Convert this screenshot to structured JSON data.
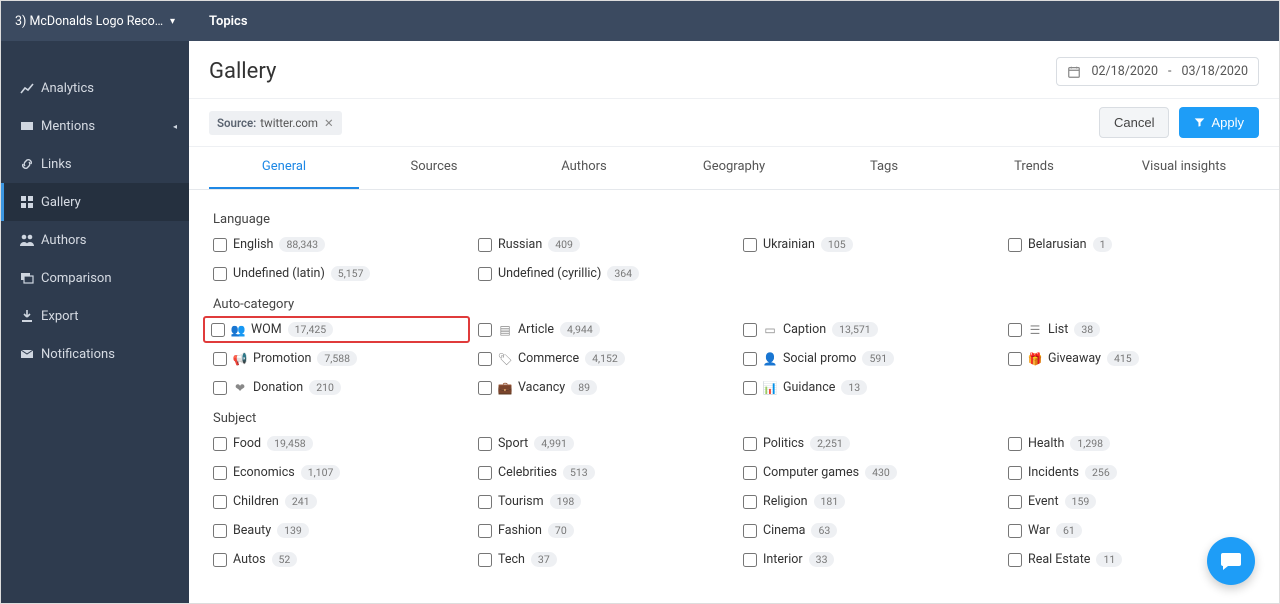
{
  "project": {
    "label": "3) McDonalds Logo Reco…"
  },
  "topbar": {
    "title": "Topics"
  },
  "nav": {
    "items": [
      {
        "label": "Analytics"
      },
      {
        "label": "Mentions"
      },
      {
        "label": "Links"
      },
      {
        "label": "Gallery"
      },
      {
        "label": "Authors"
      },
      {
        "label": "Comparison"
      },
      {
        "label": "Export"
      },
      {
        "label": "Notifications"
      }
    ]
  },
  "page": {
    "title": "Gallery"
  },
  "date_range": {
    "from": "02/18/2020",
    "sep": "-",
    "to": "03/18/2020"
  },
  "filter_chip": {
    "key": "Source:",
    "value": "twitter.com"
  },
  "buttons": {
    "cancel": "Cancel",
    "apply": "Apply"
  },
  "tabs": {
    "items": [
      {
        "label": "General"
      },
      {
        "label": "Sources"
      },
      {
        "label": "Authors"
      },
      {
        "label": "Geography"
      },
      {
        "label": "Tags"
      },
      {
        "label": "Trends"
      },
      {
        "label": "Visual insights"
      }
    ]
  },
  "sections": {
    "language": {
      "title": "Language",
      "opts": [
        {
          "label": "English",
          "count": "88,343"
        },
        {
          "label": "Russian",
          "count": "409"
        },
        {
          "label": "Ukrainian",
          "count": "105"
        },
        {
          "label": "Belarusian",
          "count": "1"
        },
        {
          "label": "Undefined (latin)",
          "count": "5,157"
        },
        {
          "label": "Undefined (cyrillic)",
          "count": "364"
        }
      ]
    },
    "auto_category": {
      "title": "Auto-category",
      "opts": [
        {
          "label": "WOM",
          "count": "17,425",
          "highlight": true
        },
        {
          "label": "Article",
          "count": "4,944"
        },
        {
          "label": "Caption",
          "count": "13,571"
        },
        {
          "label": "List",
          "count": "38"
        },
        {
          "label": "Promotion",
          "count": "7,588"
        },
        {
          "label": "Commerce",
          "count": "4,152"
        },
        {
          "label": "Social promo",
          "count": "591"
        },
        {
          "label": "Giveaway",
          "count": "415"
        },
        {
          "label": "Donation",
          "count": "210"
        },
        {
          "label": "Vacancy",
          "count": "89"
        },
        {
          "label": "Guidance",
          "count": "13"
        }
      ]
    },
    "subject": {
      "title": "Subject",
      "opts": [
        {
          "label": "Food",
          "count": "19,458"
        },
        {
          "label": "Sport",
          "count": "4,991"
        },
        {
          "label": "Politics",
          "count": "2,251"
        },
        {
          "label": "Health",
          "count": "1,298"
        },
        {
          "label": "Economics",
          "count": "1,107"
        },
        {
          "label": "Celebrities",
          "count": "513"
        },
        {
          "label": "Computer games",
          "count": "430"
        },
        {
          "label": "Incidents",
          "count": "256"
        },
        {
          "label": "Children",
          "count": "241"
        },
        {
          "label": "Tourism",
          "count": "198"
        },
        {
          "label": "Religion",
          "count": "181"
        },
        {
          "label": "Event",
          "count": "159"
        },
        {
          "label": "Beauty",
          "count": "139"
        },
        {
          "label": "Fashion",
          "count": "70"
        },
        {
          "label": "Cinema",
          "count": "63"
        },
        {
          "label": "War",
          "count": "61"
        },
        {
          "label": "Autos",
          "count": "52"
        },
        {
          "label": "Tech",
          "count": "37"
        },
        {
          "label": "Interior",
          "count": "33"
        },
        {
          "label": "Real Estate",
          "count": "11"
        }
      ]
    }
  }
}
